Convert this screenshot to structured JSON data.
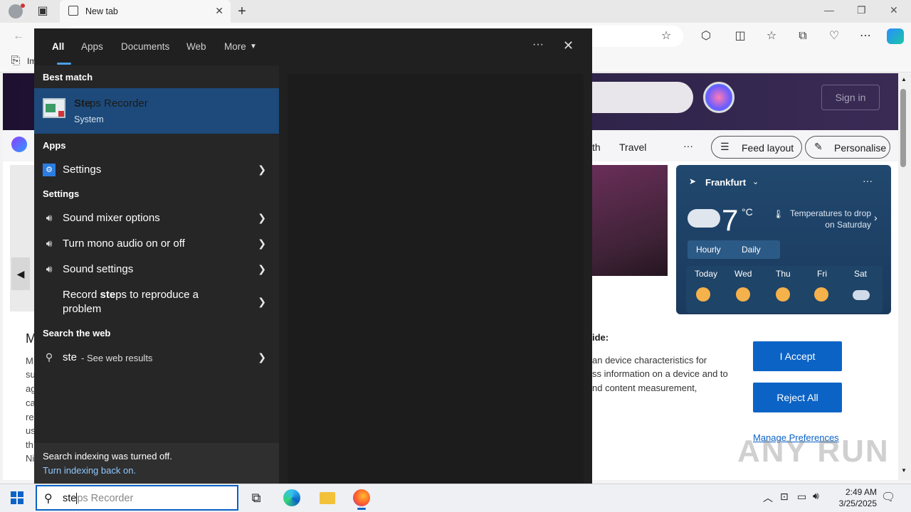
{
  "browser": {
    "tab_title": "New tab",
    "fav_truncated": "Im"
  },
  "page": {
    "sign_in": "Sign in",
    "nav_partial": "th",
    "nav_travel": "Travel",
    "nav_more": "···",
    "feed_layout": "Feed layout",
    "personalise": "Personalise",
    "weather": {
      "city": "Frankfurt",
      "temp": "7",
      "unit": "°C",
      "alert": "Temperatures to drop on Saturday",
      "tab_hourly": "Hourly",
      "tab_daily": "Daily",
      "days": [
        "Today",
        "Wed",
        "Thu",
        "Fri",
        "Sat"
      ]
    },
    "consent": {
      "heading_partial": "ide:",
      "left_letters": [
        "M",
        "M",
        "su",
        "ag",
        "ca",
        "re",
        "us",
        "th",
        "Ni"
      ],
      "text_line1": "an device characteristics for",
      "text_line2": "ss information on a device and to",
      "text_line3": "nd content measurement,",
      "accept": "I Accept",
      "reject": "Reject All",
      "manage": "Manage Preferences"
    }
  },
  "search": {
    "tabs": [
      "All",
      "Apps",
      "Documents",
      "Web",
      "More"
    ],
    "best_match_heading": "Best match",
    "best_match": {
      "title_bold": "Ste",
      "title_rest": "ps Recorder",
      "subtitle": "System"
    },
    "apps_heading": "Apps",
    "apps": [
      {
        "label": "Settings"
      }
    ],
    "settings_heading": "Settings",
    "settings": [
      {
        "label": "Sound mixer options"
      },
      {
        "label": "Turn mono audio on or off"
      },
      {
        "label": "Sound settings"
      }
    ],
    "record": {
      "pre": "Record ",
      "bold": "ste",
      "post": "ps to reproduce a",
      "line2": "problem"
    },
    "web_heading": "Search the web",
    "web": {
      "query": "ste",
      "suffix": " - See web results"
    },
    "index_off": "Search indexing was turned off.",
    "index_link": "Turn indexing back on."
  },
  "taskbar": {
    "query_typed": "ste",
    "query_suggest": "ps Recorder",
    "time": "2:49 AM",
    "date": "3/25/2025"
  },
  "watermark": "ANY RUN"
}
